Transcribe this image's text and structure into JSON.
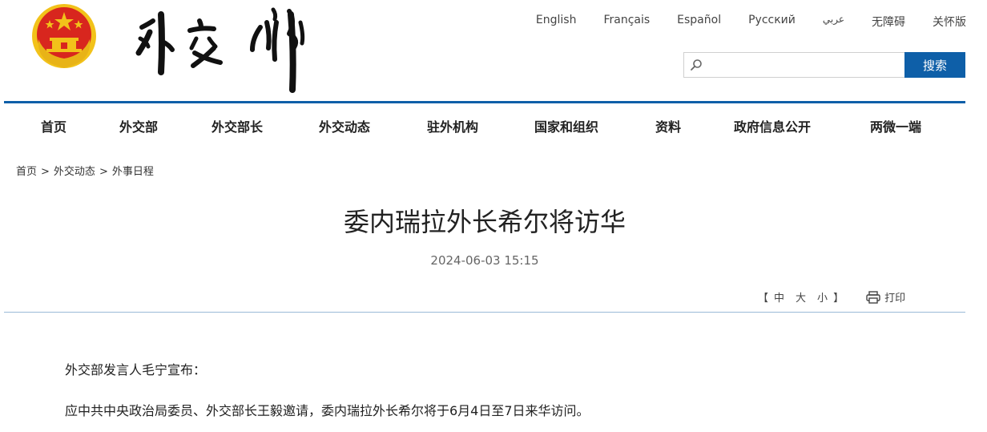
{
  "header": {
    "emblem_icon": "national-emblem-icon",
    "logo_text": "外交部",
    "languages": [
      "English",
      "Français",
      "Español",
      "Русский",
      "عربي",
      "无障碍",
      "关怀版"
    ],
    "search": {
      "placeholder": "",
      "button_label": "搜索"
    }
  },
  "nav": {
    "items": [
      "首页",
      "外交部",
      "外交部长",
      "外交动态",
      "驻外机构",
      "国家和组织",
      "资料",
      "政府信息公开",
      "两微一端"
    ]
  },
  "breadcrumb": [
    "首页",
    "外交动态",
    "外事日程"
  ],
  "breadcrumb_sep": ">",
  "article": {
    "title": "委内瑞拉外长希尔将访华",
    "date": "2024-06-03 15:15",
    "font_size": {
      "open": "【",
      "medium": "中",
      "large": "大",
      "small": "小",
      "close": "】"
    },
    "print_label": "打印",
    "paragraphs": [
      "外交部发言人毛宁宣布：",
      "应中共中央政治局委员、外交部长王毅邀请，委内瑞拉外长希尔将于6月4日至7日来华访问。"
    ]
  },
  "colors": {
    "accent": "#0e5fa8",
    "emblem_red": "#d8261e",
    "emblem_gold": "#f2c21a"
  }
}
